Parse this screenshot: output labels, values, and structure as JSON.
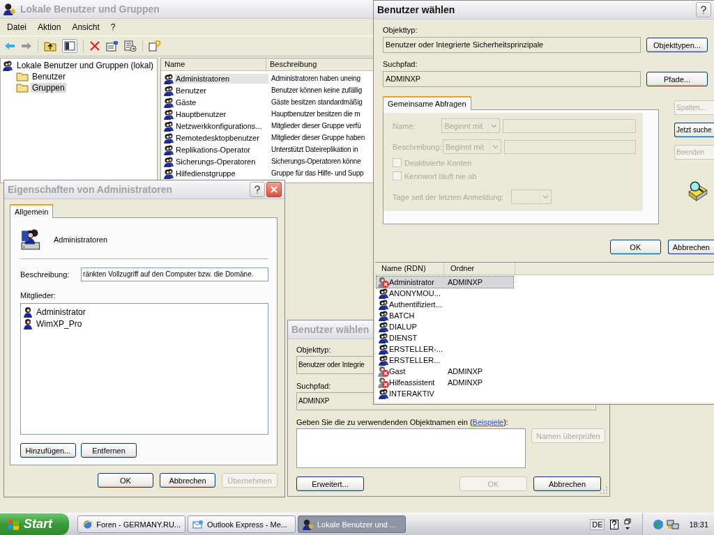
{
  "main_window": {
    "title": "Lokale Benutzer und Gruppen",
    "active": false,
    "menu": [
      "Datei",
      "Aktion",
      "Ansicht",
      "?"
    ],
    "tree": {
      "label": "Lokale Benutzer und Gruppen (lokal)",
      "children": [
        {
          "label": "Benutzer",
          "selected": false
        },
        {
          "label": "Gruppen",
          "selected": true
        }
      ]
    },
    "list": {
      "columns": [
        "Name",
        "Beschreibung"
      ],
      "rows": [
        {
          "name": "Administratoren",
          "description": "Administratoren haben uneing",
          "selected": true
        },
        {
          "name": "Benutzer",
          "description": "Benutzer können keine zufällig",
          "selected": false
        },
        {
          "name": "Gäste",
          "description": "Gäste besitzen standardmäßig",
          "selected": false
        },
        {
          "name": "Hauptbenutzer",
          "description": "Hauptbenutzer besitzen die m",
          "selected": false
        },
        {
          "name": "Netzwerkkonfigurations...",
          "description": "Mitglieder dieser Gruppe verfü",
          "selected": false
        },
        {
          "name": "Remotedesktopbenutzer",
          "description": "Mitglieder dieser Gruppe haben",
          "selected": false
        },
        {
          "name": "Replikations-Operator",
          "description": "Unterstützt Dateireplikation in",
          "selected": false
        },
        {
          "name": "Sicherungs-Operatoren",
          "description": "Sicherungs-Operatoren könne",
          "selected": false
        },
        {
          "name": "Hilfedienstgruppe",
          "description": "Gruppe für das Hilfe- und Supp",
          "selected": false
        }
      ]
    }
  },
  "properties_dialog": {
    "title": "Eigenschaften von Administratoren",
    "active": false,
    "tabs": [
      {
        "label": "Allgemein",
        "selected": true
      }
    ],
    "group_name": "Administratoren",
    "description_label": "Beschreibung:",
    "description_value": "ränkten Vollzugriff auf den Computer bzw. die Domäne.",
    "members_label": "Mitglieder:",
    "members": [
      "Administrator",
      "WimXP_Pro"
    ],
    "member_buttons": [
      {
        "label": "Hinzufügen...",
        "disabled": false
      },
      {
        "label": "Entfernen",
        "disabled": false
      }
    ],
    "buttons": [
      {
        "label": "OK",
        "disabled": false
      },
      {
        "label": "Abbrechen",
        "disabled": false
      },
      {
        "label": "Übernehmen",
        "disabled": true
      }
    ]
  },
  "select_dialog": {
    "title": "Benutzer wählen",
    "active": false,
    "object_type_label": "Objekttyp:",
    "object_type": "Benutzer oder Integrie",
    "search_path_label": "Suchpfad:",
    "search_path": "ADMINXP",
    "names_prompt": {
      "before": "Geben Sie die zu verwendenden Objektnamen ein (",
      "link": "Beispiele",
      "after": "):"
    },
    "check_button": {
      "label": "Namen überprüfen",
      "disabled": true
    },
    "buttons": [
      {
        "label": "Erweitert...",
        "disabled": false
      },
      {
        "label": "OK",
        "disabled": true
      },
      {
        "label": "Abbrechen",
        "disabled": false
      }
    ]
  },
  "advanced_dialog": {
    "title": "Benutzer wählen",
    "active": true,
    "object_type_label": "Objekttyp:",
    "object_type": "Benutzer oder Integrierte Sicherheitsprinzipale",
    "object_type_button": "Objekttypen...",
    "search_path_label": "Suchpfad:",
    "search_path": "ADMINXP",
    "search_path_button": "Pfade...",
    "tabs": [
      {
        "label": "Gemeinsame Abfragen",
        "selected": true
      }
    ],
    "query": {
      "disabled": true,
      "name_label": "Name:",
      "name_mode": "Beginnt mit",
      "description_label": "Beschreibung:",
      "description_mode": "Beginnt mit",
      "checkboxes": [
        {
          "label": "Deaktivierte Konten",
          "checked": false
        },
        {
          "label": "Kennwort läuft nie ab",
          "checked": false
        }
      ],
      "days_label": "Tage seit der letzten Anmeldung:"
    },
    "side_buttons": [
      {
        "label": "Spalten...",
        "disabled": true
      },
      {
        "label": "Jetzt suche",
        "disabled": false
      },
      {
        "label": "Beenden",
        "disabled": true
      }
    ],
    "buttons": [
      {
        "label": "OK",
        "disabled": false
      },
      {
        "label": "Abbrechen",
        "disabled": false
      }
    ],
    "results": {
      "columns": [
        "Name (RDN)",
        "Ordner"
      ],
      "rows": [
        {
          "name": "Administrator",
          "folder": "ADMINXP",
          "kind": "user",
          "disabled": true,
          "selected": true
        },
        {
          "name": "ANONYMOU...",
          "kind": "group",
          "disabled": false,
          "selected": false
        },
        {
          "name": "Authentifiziert...",
          "kind": "group",
          "disabled": false,
          "selected": false
        },
        {
          "name": "BATCH",
          "kind": "group",
          "disabled": false,
          "selected": false
        },
        {
          "name": "DIALUP",
          "kind": "group",
          "disabled": false,
          "selected": false
        },
        {
          "name": "DIENST",
          "kind": "group",
          "disabled": false,
          "selected": false
        },
        {
          "name": "ERSTELLER-...",
          "kind": "group",
          "disabled": false,
          "selected": false
        },
        {
          "name": "ERSTELLER...",
          "kind": "group",
          "disabled": false,
          "selected": false
        },
        {
          "name": "Gast",
          "folder": "ADMINXP",
          "kind": "user",
          "disabled": true,
          "selected": false
        },
        {
          "name": "Hilfeassistent",
          "folder": "ADMINXP",
          "kind": "user",
          "disabled": true,
          "selected": false
        },
        {
          "name": "INTERAKTIV",
          "kind": "group",
          "disabled": false,
          "selected": false
        }
      ]
    }
  },
  "taskbar": {
    "start": "Start",
    "tasks": [
      {
        "label": "Foren - GERMANY.RU...",
        "selected": false
      },
      {
        "label": "Outlook Express - Me...",
        "selected": false
      },
      {
        "label": "Lokale Benutzer und ...",
        "selected": true
      }
    ],
    "language": "DE",
    "clock": "18:31"
  }
}
